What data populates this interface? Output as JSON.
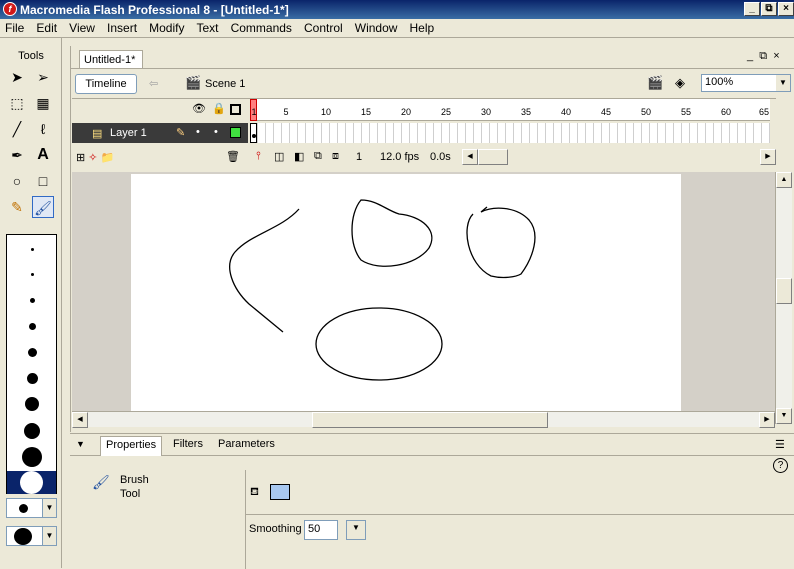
{
  "window": {
    "title": "Macromedia Flash Professional 8 - [Untitled-1*]",
    "app_icon": "flash-logo-icon",
    "controls": [
      "_",
      "⧉",
      "×"
    ]
  },
  "menu": [
    "File",
    "Edit",
    "View",
    "Insert",
    "Modify",
    "Text",
    "Commands",
    "Control",
    "Window",
    "Help"
  ],
  "tools": {
    "header": "Tools",
    "items": [
      "arrow-icon",
      "subselect-icon",
      "free-transform-icon",
      "gradient-transform-icon",
      "line-icon",
      "lasso-icon",
      "pen-icon",
      "text-icon",
      "oval-icon",
      "rectangle-icon",
      "pencil-icon",
      "brush-icon"
    ],
    "selected": "brush-icon",
    "brush_sizes_count": 10,
    "brush_size_selected": 10
  },
  "document": {
    "tab": "Untitled-1*",
    "timeline_button": "Timeline",
    "scene": "Scene 1",
    "zoom": "100%"
  },
  "timeline": {
    "ruler": [
      "1",
      "5",
      "10",
      "15",
      "20",
      "25",
      "30",
      "35",
      "40",
      "45",
      "50",
      "55",
      "60",
      "65"
    ],
    "layer_name": "Layer 1",
    "current_frame": "1",
    "fps": "12.0 fps",
    "elapsed": "0.0s"
  },
  "properties": {
    "tabs": [
      "Properties",
      "Filters",
      "Parameters"
    ],
    "active_tab": "Properties",
    "tool_name_line1": "Brush",
    "tool_name_line2": "Tool",
    "fill_color": "#a8c8f0",
    "smoothing_label": "Smoothing",
    "smoothing_value": "50",
    "help": "?"
  },
  "colors": {
    "title_start": "#0a246a",
    "title_end": "#3a6ea5",
    "chrome": "#ece9d8",
    "stage": "#ffffff",
    "playhead": "#ff8080"
  }
}
